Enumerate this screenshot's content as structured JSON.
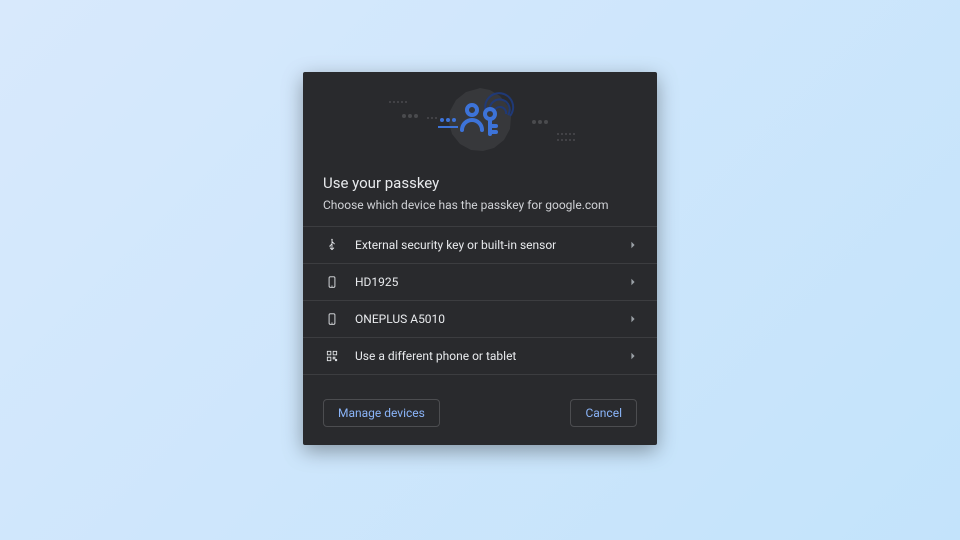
{
  "dialog": {
    "title": "Use your passkey",
    "subtitle": "Choose which device has the passkey for google.com",
    "options": [
      {
        "icon": "usb-icon",
        "label": "External security key or built-in sensor"
      },
      {
        "icon": "phone-icon",
        "label": "HD1925"
      },
      {
        "icon": "phone-icon",
        "label": "ONEPLUS A5010"
      },
      {
        "icon": "qr-icon",
        "label": "Use a different phone or tablet"
      }
    ],
    "manage_label": "Manage devices",
    "cancel_label": "Cancel"
  },
  "colors": {
    "accent": "#8ab4f8",
    "hero_blue": "#3d73d8",
    "dialog_bg": "#292a2d"
  }
}
